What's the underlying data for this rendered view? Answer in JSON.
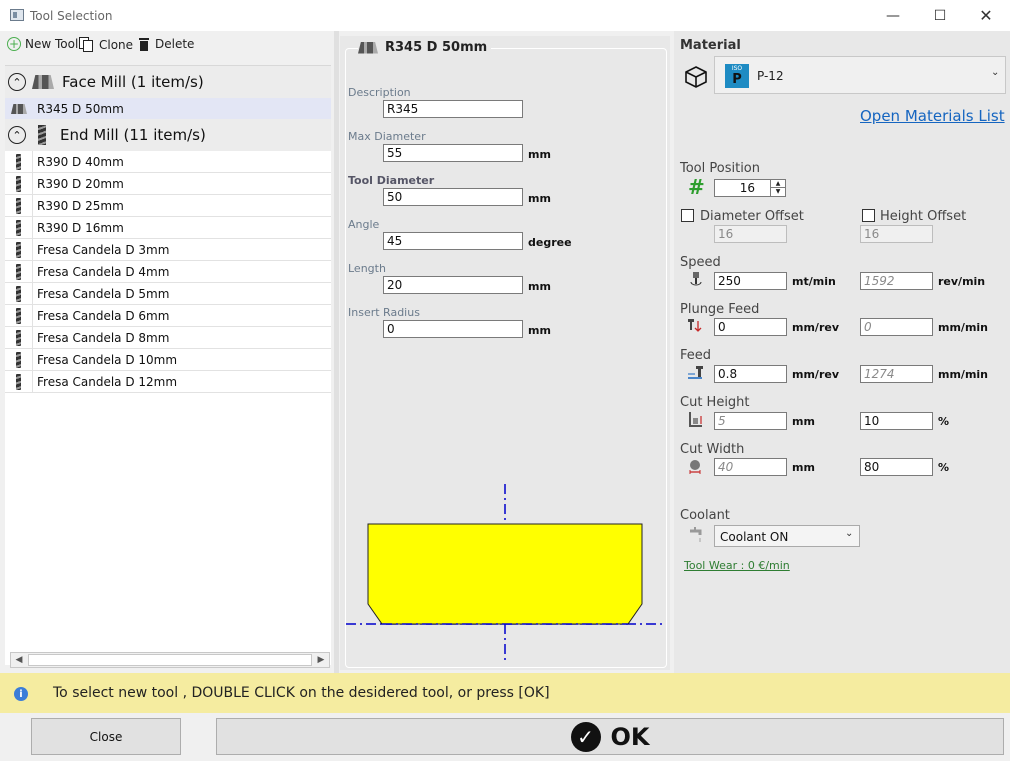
{
  "window": {
    "title": "Tool Selection"
  },
  "toolbar": {
    "new_tool": "New Tool",
    "clone": "Clone",
    "delete": "Delete"
  },
  "tree": {
    "groups": [
      {
        "label": "Face Mill (1 item/s)",
        "items": [
          "R345 D 50mm"
        ]
      },
      {
        "label": "End Mill (11 item/s)",
        "items": [
          "R390 D 40mm",
          "R390 D 20mm",
          "R390 D 25mm",
          "R390 D 16mm",
          "Fresa Candela D 3mm",
          "Fresa Candela D 4mm",
          "Fresa Candela D 5mm",
          "Fresa Candela D 6mm",
          "Fresa Candela D 8mm",
          "Fresa Candela D 10mm",
          "Fresa Candela D 12mm"
        ]
      }
    ],
    "selected_item": "R345 D 50mm"
  },
  "tool": {
    "name": "R345 D 50mm",
    "fields": [
      {
        "label": "Description",
        "value": "R345",
        "unit": ""
      },
      {
        "label": "Max Diameter",
        "value": "55",
        "unit": "mm"
      },
      {
        "label": "Tool Diameter",
        "value": "50",
        "unit": "mm"
      },
      {
        "label": "Angle",
        "value": "45",
        "unit": "degree"
      },
      {
        "label": "Length",
        "value": "20",
        "unit": "mm"
      },
      {
        "label": "Insert Radius",
        "value": "0",
        "unit": "mm"
      }
    ]
  },
  "material": {
    "heading": "Material",
    "iso_label": "ISO",
    "iso_class": "P",
    "selected": "P-12",
    "open_list": "Open Materials List",
    "iso_color": "#1e8bc3"
  },
  "position": {
    "label": "Tool Position",
    "value": "16"
  },
  "offsets": {
    "diameter_label": "Diameter Offset",
    "diameter_value": "16",
    "height_label": "Height Offset",
    "height_value": "16"
  },
  "cutting": {
    "speed": {
      "label": "Speed",
      "value": "250",
      "unit": "mt/min",
      "value2": "1592",
      "unit2": "rev/min"
    },
    "plunge": {
      "label": "Plunge Feed",
      "value": "0",
      "unit": "mm/rev",
      "value2": "0",
      "unit2": "mm/min"
    },
    "feed": {
      "label": "Feed",
      "value": "0.8",
      "unit": "mm/rev",
      "value2": "1274",
      "unit2": "mm/min"
    },
    "cut_height": {
      "label": "Cut Height",
      "value": "5",
      "unit": "mm",
      "value2": "10",
      "unit2": "%"
    },
    "cut_width": {
      "label": "Cut Width",
      "value": "40",
      "unit": "mm",
      "value2": "80",
      "unit2": "%"
    }
  },
  "coolant": {
    "label": "Coolant",
    "selected": "Coolant ON"
  },
  "tool_wear": "Tool Wear : 0 €/min",
  "status": {
    "message": "To select new tool , DOUBLE CLICK on the desidered tool, or press [OK]"
  },
  "buttons": {
    "close": "Close",
    "ok": "OK"
  },
  "colors": {
    "tool_fill": "#ffff00",
    "axis": "#0000cc",
    "link": "#1565c0",
    "wear": "#2e7d32",
    "status_bg": "#f5eca0",
    "hash": "#2e9e2e"
  }
}
